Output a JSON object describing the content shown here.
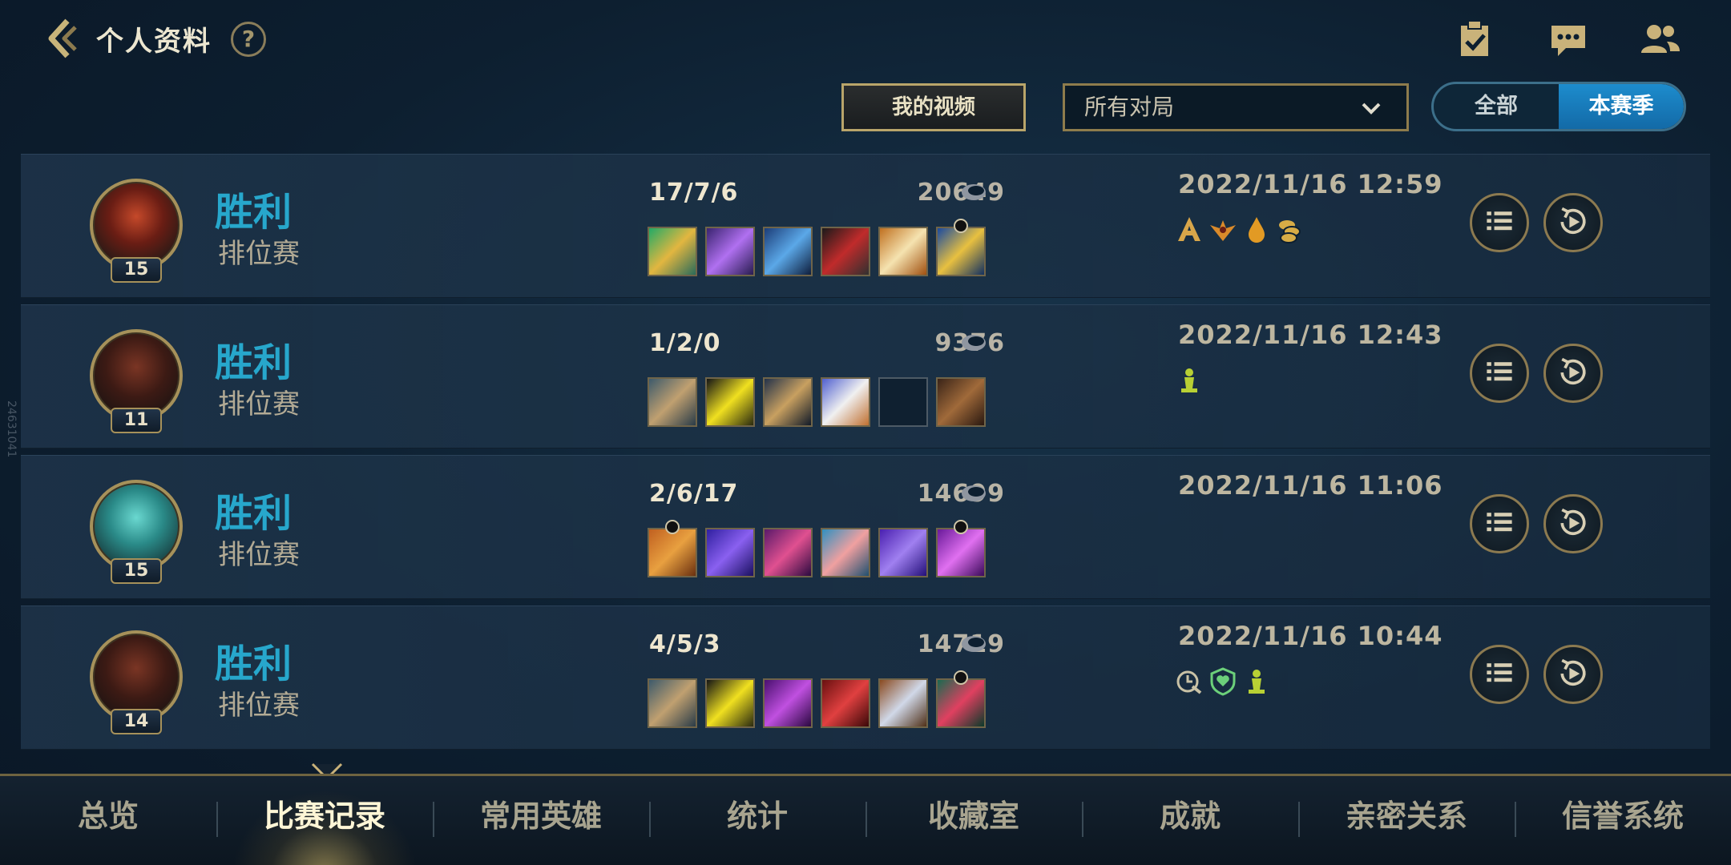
{
  "header": {
    "title": "个人资料",
    "help": "?",
    "icons": [
      "back-icon",
      "help-icon",
      "checklist-icon",
      "chat-icon",
      "friends-icon"
    ]
  },
  "filters": {
    "video_label": "我的视频",
    "match_select": "所有对局",
    "season_toggle": {
      "all": "全部",
      "season": "本赛季"
    }
  },
  "matches": [
    {
      "result": "胜利",
      "mode": "排位赛",
      "level": "15",
      "kda": "17/7/6",
      "gold": "20649",
      "datetime": "2022/11/16 12:59",
      "badges": [
        "a-rank-icon",
        "winged-crest-icon",
        "blood-drop-icon",
        "coins-icon"
      ]
    },
    {
      "result": "胜利",
      "mode": "排位赛",
      "level": "11",
      "kda": "1/2/0",
      "gold": "9376",
      "datetime": "2022/11/16 12:43",
      "badges": [
        "ward-icon"
      ]
    },
    {
      "result": "胜利",
      "mode": "排位赛",
      "level": "15",
      "kda": "2/6/17",
      "gold": "14699",
      "datetime": "2022/11/16 11:06",
      "badges": []
    },
    {
      "result": "胜利",
      "mode": "排位赛",
      "level": "14",
      "kda": "4/5/3",
      "gold": "14719",
      "datetime": "2022/11/16 10:44",
      "badges": [
        "timer-icon",
        "shield-heart-icon",
        "ward-icon"
      ]
    }
  ],
  "side_id": "24631041",
  "nav": {
    "tabs": [
      "总览",
      "比赛记录",
      "常用英雄",
      "统计",
      "收藏室",
      "成就",
      "亲密关系",
      "信誉系统"
    ],
    "active": "比赛记录"
  },
  "colors": {
    "victory": "#27a7cc",
    "gold_border": "#a6915a",
    "toggle_active": "#1d8ccd",
    "background": "#0d1f30"
  }
}
